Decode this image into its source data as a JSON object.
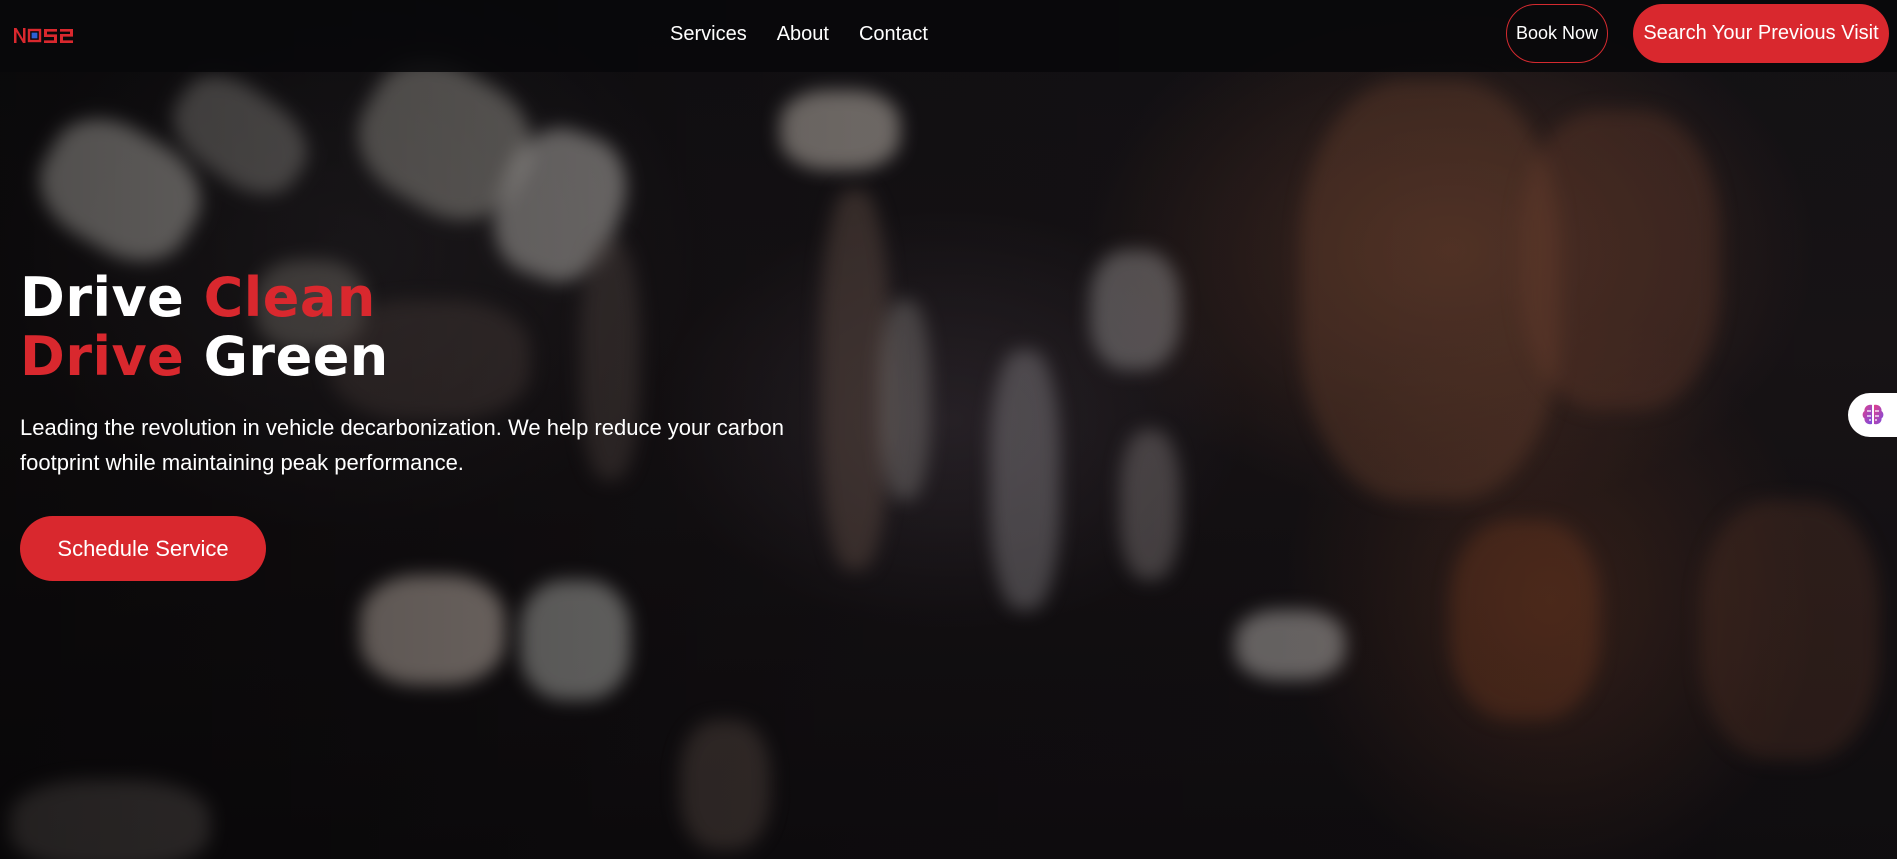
{
  "brand": {
    "logo_text": "NOS2",
    "colors": {
      "accent": "#d9282e",
      "logo_blue": "#2d5fd3"
    }
  },
  "nav": {
    "links": [
      {
        "label": "Services"
      },
      {
        "label": "About"
      },
      {
        "label": "Contact"
      }
    ],
    "book_label": "Book Now",
    "search_label": "Search Your Previous Visit"
  },
  "hero": {
    "headline_line1": {
      "part1": "Drive",
      "part2": "Clean"
    },
    "headline_line2": {
      "part1": "Drive",
      "part2": "Green"
    },
    "subtext": "Leading the revolution in vehicle decarbonization. We help reduce your carbon footprint while maintaining peak performance.",
    "cta_label": "Schedule Service"
  },
  "side_widget": {
    "icon": "brain-icon"
  }
}
